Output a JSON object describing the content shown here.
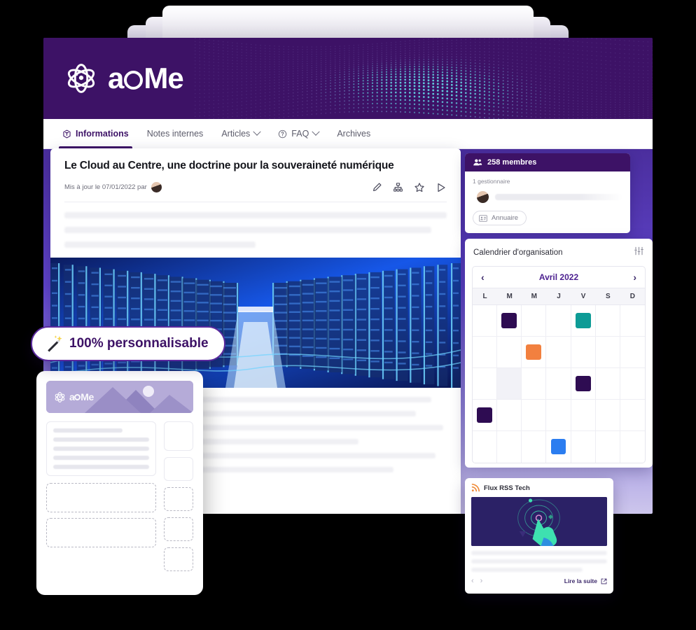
{
  "brand": {
    "name": "acMe",
    "logo_icon": "atom-icon",
    "accent": "#3d1266",
    "accent_light": "#5b2a9e"
  },
  "nav": {
    "items": [
      {
        "label": "Informations",
        "icon": "info-hex-icon",
        "active": true,
        "has_chevron": false
      },
      {
        "label": "Notes internes",
        "icon": "",
        "active": false,
        "has_chevron": false
      },
      {
        "label": "Articles",
        "icon": "",
        "active": false,
        "has_chevron": true
      },
      {
        "label": "FAQ",
        "icon": "question-circle-icon",
        "active": false,
        "has_chevron": true
      },
      {
        "label": "Archives",
        "icon": "",
        "active": false,
        "has_chevron": false
      }
    ]
  },
  "article": {
    "title": "Le Cloud au Centre, une doctrine pour la souveraineté numérique",
    "meta_prefix": "Mis à jour le 07/01/2022 par",
    "author_avatar": "avatar",
    "actions": [
      {
        "name": "edit-icon",
        "title": "Modifier"
      },
      {
        "name": "org-chart-icon",
        "title": "Organigramme"
      },
      {
        "name": "star-icon",
        "title": "Favori"
      },
      {
        "name": "send-icon",
        "title": "Partager"
      }
    ],
    "image_alt": "data-center-photo"
  },
  "members": {
    "icon": "users-icon",
    "count_label": "258 membres",
    "manager_label": "1 gestionnaire",
    "directory_button": {
      "label": "Annuaire",
      "icon": "id-card-icon"
    }
  },
  "calendar": {
    "title": "Calendrier d'organisation",
    "settings_icon": "sliders-icon",
    "prev_icon": "chevron-left-icon",
    "next_icon": "chevron-right-icon",
    "month": "Avril 2022",
    "day_headers": [
      "L",
      "M",
      "M",
      "J",
      "V",
      "S",
      "D"
    ],
    "weeks": 5,
    "events": [
      {
        "row": 0,
        "col": 1,
        "color": "#2e0c52"
      },
      {
        "row": 0,
        "col": 4,
        "color": "#0d9b96"
      },
      {
        "row": 1,
        "col": 2,
        "color": "#f2803f"
      },
      {
        "row": 2,
        "col": 4,
        "color": "#2e0c52"
      },
      {
        "row": 3,
        "col": 0,
        "color": "#2e0c52"
      },
      {
        "row": 4,
        "col": 3,
        "color": "#2b7df0"
      }
    ],
    "shaded_cells": [
      {
        "row": 2,
        "col": 1
      }
    ]
  },
  "rss": {
    "icon": "rss-icon",
    "title": "Flux RSS Tech",
    "thumbnail_alt": "hand-touching-interface-illustration",
    "prev_icon": "chevron-left-icon",
    "next_icon": "chevron-right-icon",
    "read_more": "Lire la suite",
    "external_icon": "external-link-icon"
  },
  "badge": {
    "icon": "magic-wand-icon",
    "text": "100% personnalisable"
  },
  "template_card": {
    "logo_text": "acMe",
    "hero_alt": "mountains-placeholder-image",
    "dashed_slots": 5,
    "solid_slots": 2
  }
}
